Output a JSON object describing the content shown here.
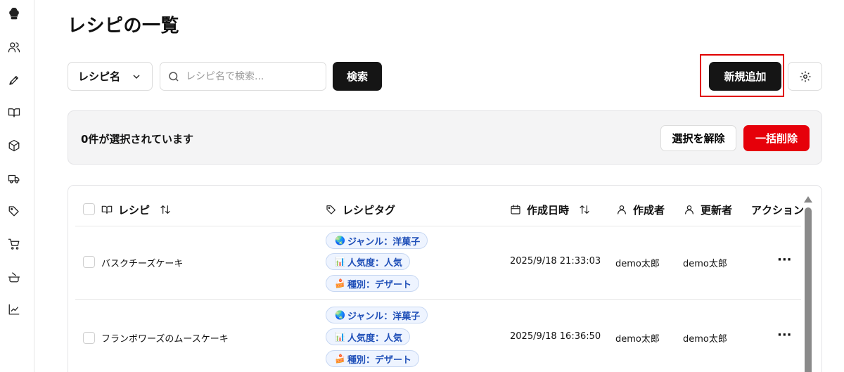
{
  "sidebar": {
    "icons": [
      "chef-hat-icon",
      "users-icon",
      "pen-icon",
      "book-open-icon",
      "box-icon",
      "truck-icon",
      "tags-icon",
      "cart-icon",
      "cooking-pot-icon",
      "chart-line-icon"
    ]
  },
  "page": {
    "title": "レシピの一覧"
  },
  "toolbar": {
    "field_select": "レシピ名",
    "search_placeholder": "レシピ名で検索...",
    "search_button": "検索",
    "new_button": "新規追加",
    "settings_icon": "gear-icon"
  },
  "selection": {
    "count_text": "0件が選択されています",
    "deselect_button": "選択を解除",
    "bulk_delete_button": "一括削除"
  },
  "table": {
    "headers": {
      "recipe": "レシピ",
      "tags": "レシピタグ",
      "created_at": "作成日時",
      "creator": "作成者",
      "updater": "更新者",
      "actions": "アクション"
    },
    "rows": [
      {
        "name": "バスクチーズケーキ",
        "tags": [
          {
            "emoji": "🌏",
            "label": "ジャンル：洋菓子"
          },
          {
            "emoji": "📊",
            "label": "人気度：人気"
          },
          {
            "emoji": "🍰",
            "label": "種別：デザート"
          }
        ],
        "created_at": "2025/9/18 21:33:03",
        "creator": "demo太郎",
        "updater": "demo太郎",
        "action": "···"
      },
      {
        "name": "フランボワーズのムースケーキ",
        "tags": [
          {
            "emoji": "🌏",
            "label": "ジャンル：洋菓子"
          },
          {
            "emoji": "📊",
            "label": "人気度：人気"
          },
          {
            "emoji": "🍰",
            "label": "種別：デザート"
          }
        ],
        "created_at": "2025/9/18 16:36:50",
        "creator": "demo太郎",
        "updater": "demo太郎",
        "action": "···"
      }
    ]
  }
}
